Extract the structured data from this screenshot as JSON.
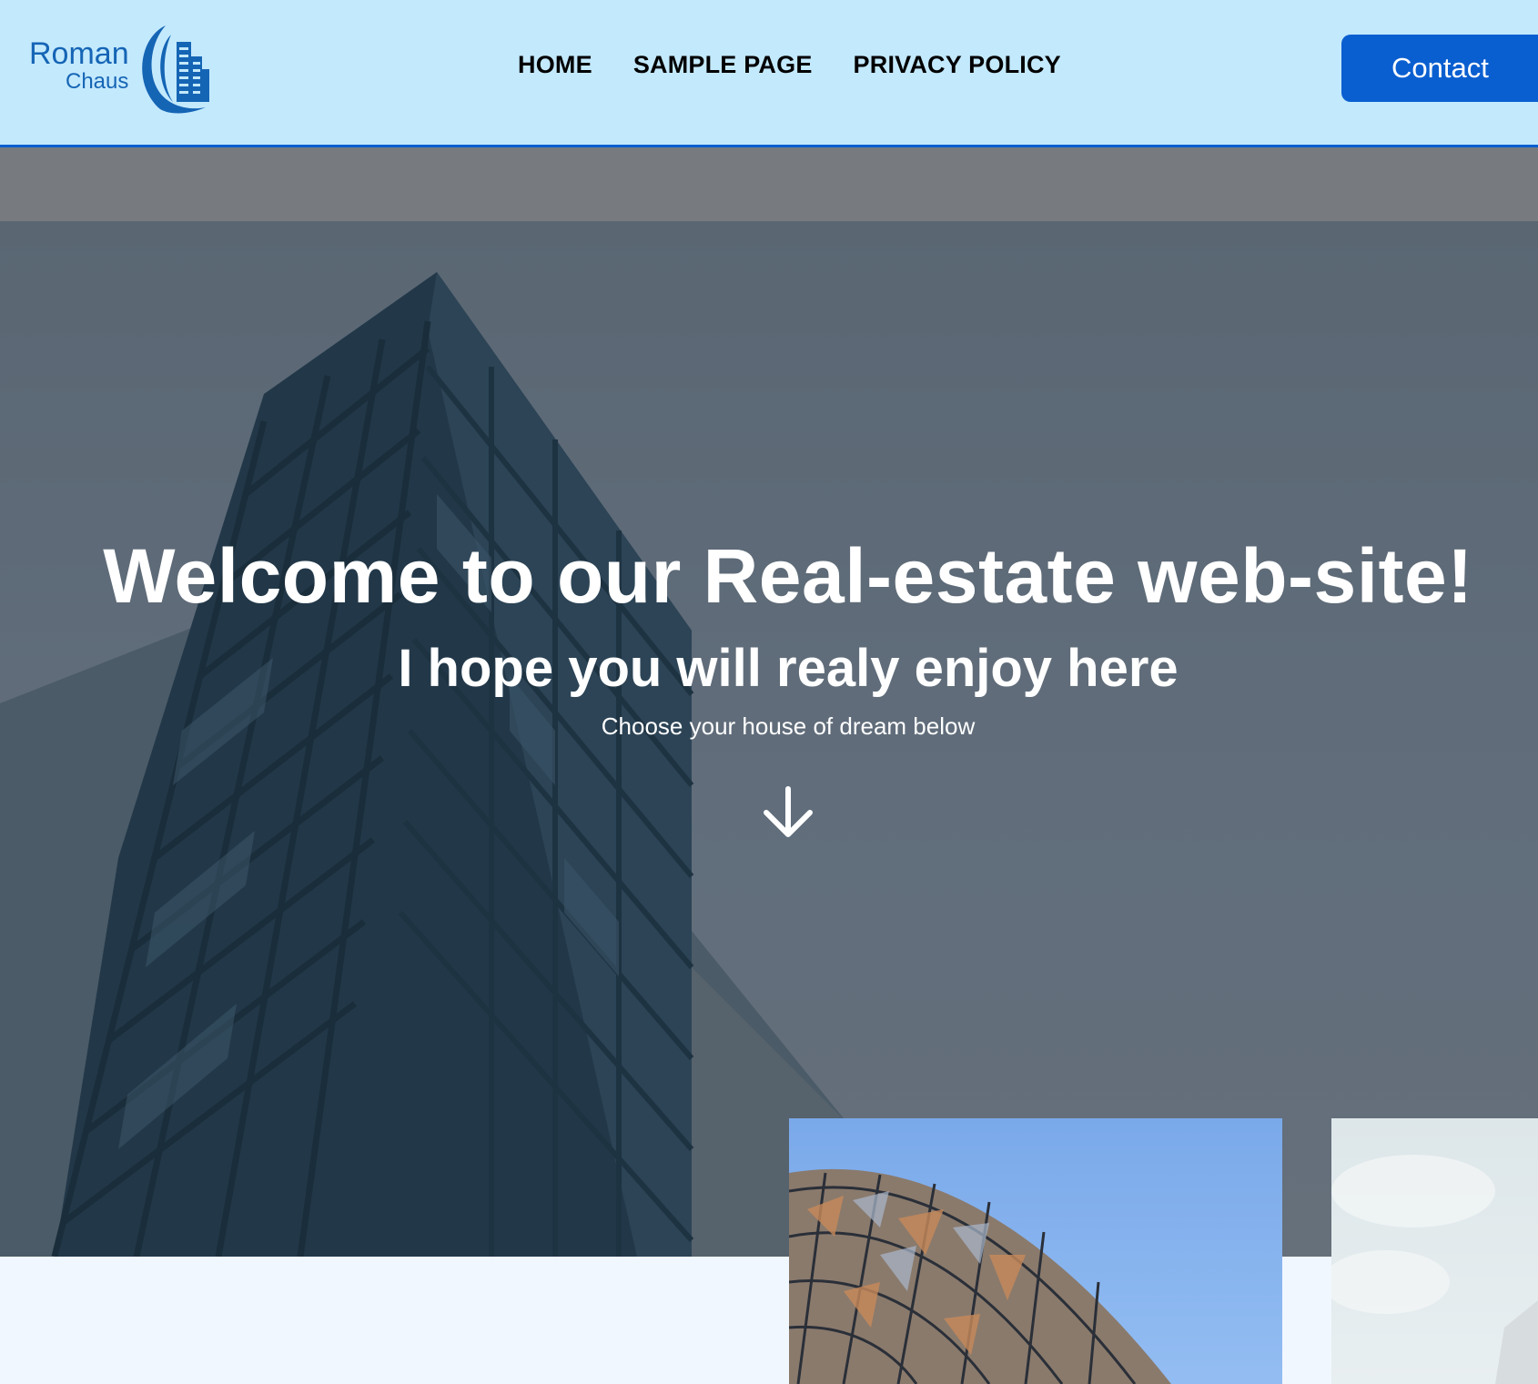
{
  "header": {
    "logo": {
      "line1": "Roman",
      "line2": "Chaus"
    },
    "nav": [
      {
        "label": "HOME"
      },
      {
        "label": "SAMPLE PAGE"
      },
      {
        "label": "PRIVACY POLICY"
      }
    ],
    "contact_label": "Contact"
  },
  "hero": {
    "title": "Welcome to our Real-estate web-site!",
    "subtitle": "I hope you will realy enjoy here",
    "caption": "Choose your house of dream below",
    "scroll_icon": "arrow-down-icon"
  },
  "colors": {
    "header_bg": "#c3e9fd",
    "accent": "#0a5fd0",
    "page_bg": "#f0f7ff"
  }
}
